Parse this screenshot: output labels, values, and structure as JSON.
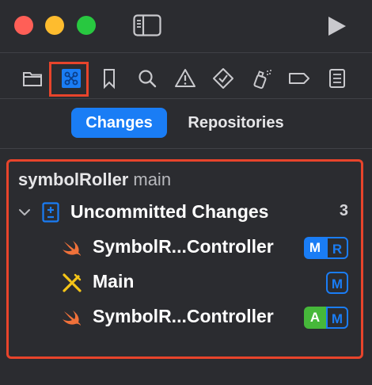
{
  "window": {
    "traffic_lights": [
      "close",
      "minimize",
      "zoom"
    ],
    "run_icon": "play-icon",
    "sidebar_icon": "sidebar-toggle-icon"
  },
  "navigator_tabs": [
    {
      "icon": "folder-icon"
    },
    {
      "icon": "source-control-icon",
      "selected": true
    },
    {
      "icon": "bookmark-icon"
    },
    {
      "icon": "search-icon"
    },
    {
      "icon": "warning-icon"
    },
    {
      "icon": "test-diamond-icon"
    },
    {
      "icon": "debug-spray-icon"
    },
    {
      "icon": "breakpoint-tag-icon"
    },
    {
      "icon": "report-icon"
    }
  ],
  "segments": {
    "changes": "Changes",
    "repositories": "Repositories",
    "selected": "Changes"
  },
  "repo": {
    "name": "symbolRoller",
    "branch": "main"
  },
  "group": {
    "label": "Uncommitted Changes",
    "count": "3"
  },
  "files": [
    {
      "name": "SymbolR...Controller",
      "icon": "swift-icon",
      "badges": [
        "M",
        "R"
      ]
    },
    {
      "name": "Main",
      "icon": "storyboard-icon",
      "badges": [
        "M"
      ]
    },
    {
      "name": "SymbolR...Controller",
      "icon": "swift-icon",
      "badges": [
        "A",
        "M"
      ]
    }
  ],
  "colors": {
    "background": "#2b2c30",
    "accent": "#1a7df5",
    "highlight_border": "#e8442b",
    "added_green": "#46b83a",
    "swift_orange": "#f0713a",
    "storyboard_yellow": "#f5c518"
  }
}
